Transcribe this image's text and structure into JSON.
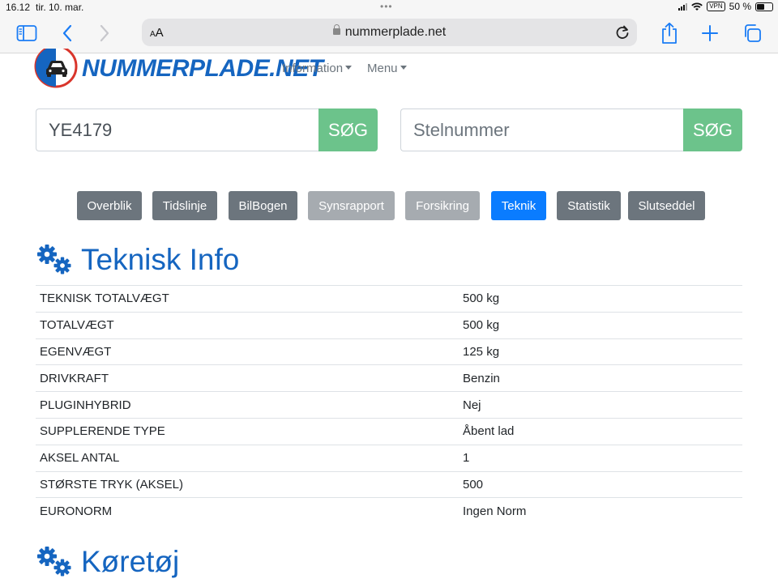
{
  "status_bar": {
    "time": "16.12",
    "date": "tir. 10. mar.",
    "vpn": "VPN",
    "battery": "50 %"
  },
  "browser": {
    "aa_label": "AA",
    "url": "nummerplade.net"
  },
  "site": {
    "logo_text": "NUMMERPLADE.NET",
    "nav": [
      {
        "label": "Information"
      },
      {
        "label": "Menu"
      }
    ]
  },
  "search": {
    "plate_value": "YE4179",
    "plate_button": "SØG",
    "vin_placeholder": "Stelnummer",
    "vin_button": "SØG"
  },
  "tabs": [
    {
      "label": "Overblik",
      "state": "dark"
    },
    {
      "label": "Tidslinje",
      "state": "dark"
    },
    {
      "label": "BilBogen",
      "state": "dark"
    },
    {
      "label": "Synsrapport",
      "state": "light"
    },
    {
      "label": "Forsikring",
      "state": "light"
    },
    {
      "label": "Teknik",
      "state": "active"
    },
    {
      "label": "Statistik",
      "state": "dark"
    },
    {
      "label": "Slutseddel",
      "state": "dark"
    }
  ],
  "technical": {
    "title": "Teknisk Info",
    "rows": [
      {
        "label": "TEKNISK TOTALVÆGT",
        "value": "500 kg"
      },
      {
        "label": "TOTALVÆGT",
        "value": "500 kg"
      },
      {
        "label": "EGENVÆGT",
        "value": "125 kg"
      },
      {
        "label": "DRIVKRAFT",
        "value": "Benzin"
      },
      {
        "label": "PLUGINHYBRID",
        "value": "Nej"
      },
      {
        "label": "SUPPLERENDE TYPE",
        "value": "Åbent lad"
      },
      {
        "label": "AKSEL ANTAL",
        "value": "1"
      },
      {
        "label": "STØRSTE TRYK (AKSEL)",
        "value": "500"
      },
      {
        "label": "EURONORM",
        "value": "Ingen Norm"
      }
    ]
  },
  "vehicle": {
    "title": "Køretøj"
  },
  "colors": {
    "brand_blue": "#1565c0",
    "search_green": "#6cc38b",
    "tab_active": "#0a7cff",
    "tab_dark": "#6c757d",
    "tab_light": "#a6abb0",
    "ios_blue": "#1a7cf5"
  },
  "icons": [
    "sidebar-icon",
    "back-chevron-icon",
    "forward-chevron-icon",
    "lock-icon",
    "reload-icon",
    "share-icon",
    "plus-icon",
    "tabs-icon",
    "gears-icon",
    "car-logo-icon",
    "wifi-icon",
    "battery-icon"
  ]
}
